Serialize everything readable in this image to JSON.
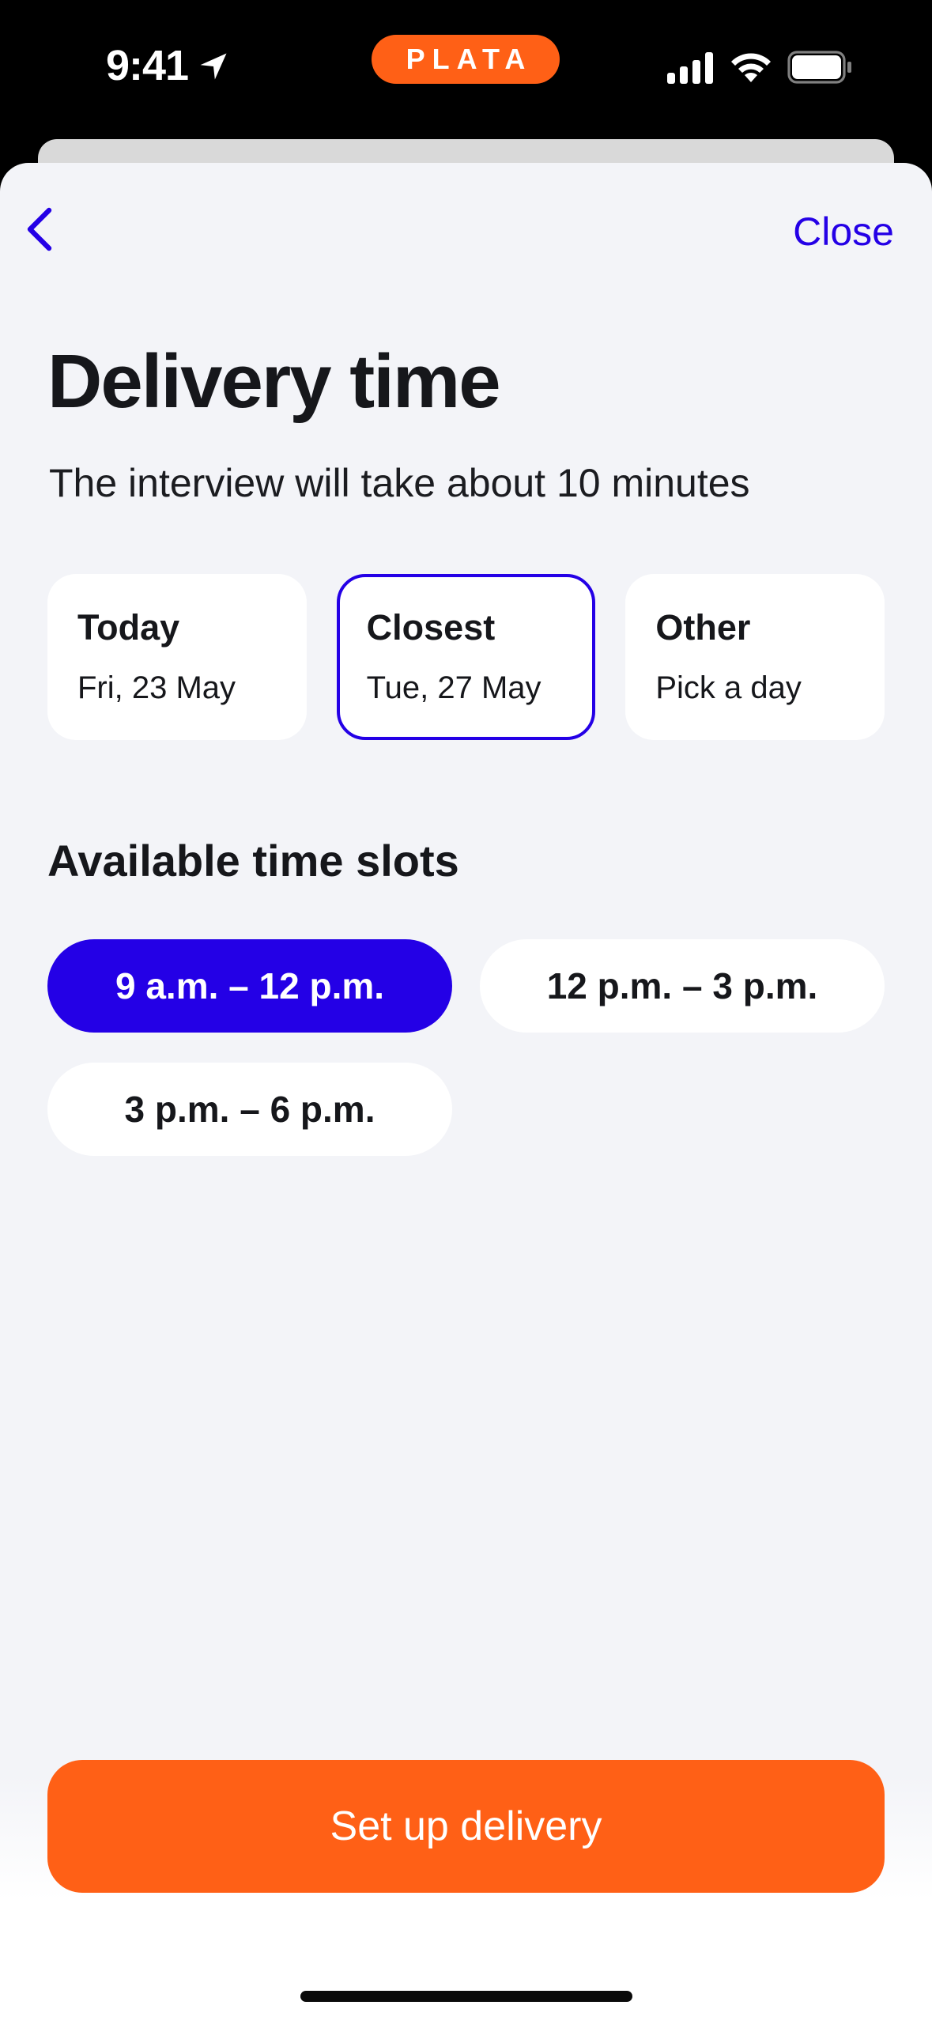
{
  "status_bar": {
    "time": "9:41",
    "brand": "PLATA",
    "brand_color": "#ff6016",
    "icons": [
      "location-arrow-icon",
      "cellular-signal-icon",
      "wifi-icon",
      "battery-icon"
    ]
  },
  "nav": {
    "back_icon": "chevron-left-icon",
    "close_label": "Close",
    "accent_color": "#2400e6"
  },
  "header": {
    "title": "Delivery time",
    "subtitle": "The interview will take about 10 minutes"
  },
  "day_options": [
    {
      "title": "Today",
      "date": "Fri, 23 May",
      "selected": false
    },
    {
      "title": "Closest",
      "date": "Tue, 27 May",
      "selected": true
    },
    {
      "title": "Other",
      "date": "Pick a day",
      "selected": false
    }
  ],
  "time_slots": {
    "heading": "Available time slots",
    "options": [
      {
        "label": "9 a.m. – 12 p.m.",
        "selected": true
      },
      {
        "label": "12 p.m. – 3 p.m.",
        "selected": false
      },
      {
        "label": "3 p.m. – 6 p.m.",
        "selected": false
      }
    ]
  },
  "footer": {
    "primary_label": "Set up delivery",
    "primary_color": "#ff6016"
  }
}
